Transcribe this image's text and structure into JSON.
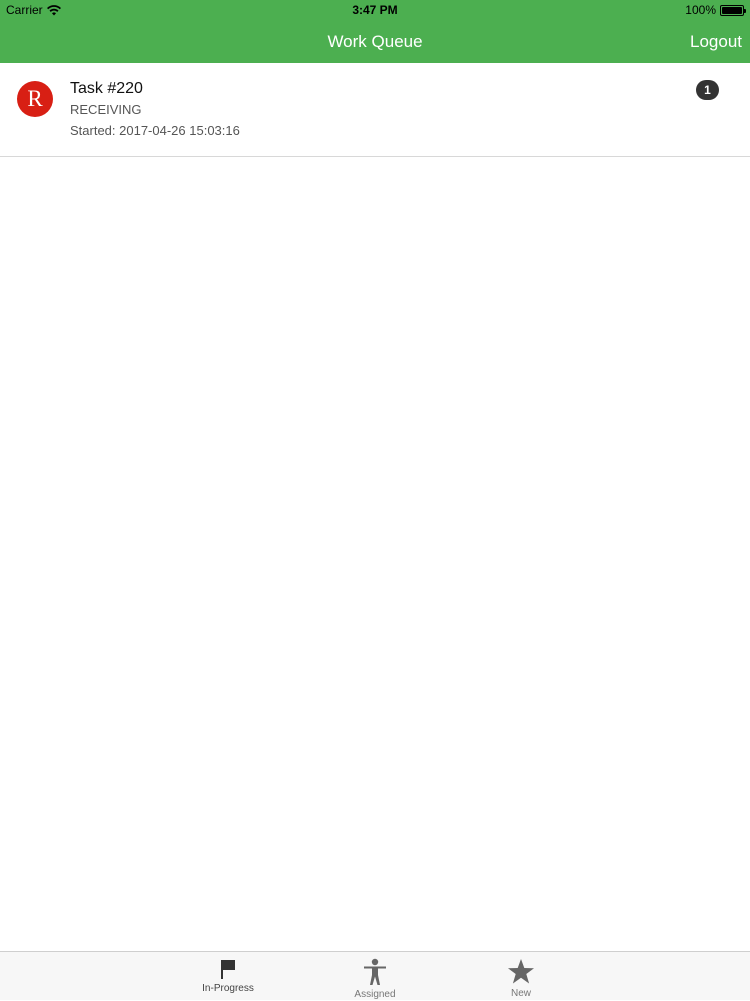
{
  "status_bar": {
    "carrier": "Carrier",
    "time": "3:47 PM",
    "battery": "100%",
    "battery_level": 1.0
  },
  "nav": {
    "title": "Work Queue",
    "logout_label": "Logout"
  },
  "tasks": [
    {
      "avatar_letter": "R",
      "avatar_color": "#d81f14",
      "title": "Task #220",
      "type": "RECEIVING",
      "started": "Started: 2017-04-26 15:03:16",
      "badge": "1"
    }
  ],
  "tabs": [
    {
      "label": "In-Progress",
      "icon": "flag-icon",
      "active": true
    },
    {
      "label": "Assigned",
      "icon": "person-icon",
      "active": false
    },
    {
      "label": "New",
      "icon": "star-icon",
      "active": false
    }
  ],
  "colors": {
    "accent": "#4caf50",
    "badge": "#333333"
  }
}
